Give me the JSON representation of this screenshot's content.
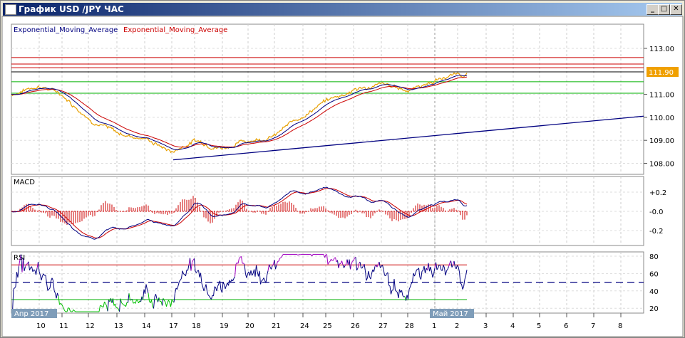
{
  "window": {
    "title": "График USD /JPY  ЧАС",
    "minimize": "_",
    "maximize": "□",
    "close": "✕"
  },
  "legend": {
    "ema_fast": "Exponential_Moving_Average",
    "ema_slow": "Exponential_Moving_Average"
  },
  "colors": {
    "price": "#e8a000",
    "ema_fast": "#000080",
    "ema_slow": "#cc0000",
    "level_red": "#cc0000",
    "level_green": "#00b000",
    "trend": "#000080",
    "current": "#f0a000"
  },
  "chart_data": [
    {
      "type": "line",
      "title": "USD/JPY H1",
      "ylabel": "",
      "ylim": [
        107.8,
        113.9
      ],
      "y_ticks": [
        "113.00",
        "111.00",
        "110.00",
        "109.00",
        "108.00"
      ],
      "current_price_label": "111.90",
      "x_ticks": [
        "10",
        "11",
        "12",
        "13",
        "14",
        "17",
        "18",
        "19",
        "20",
        "21",
        "24",
        "25",
        "26",
        "27",
        "28",
        "1",
        "2",
        "3",
        "4",
        "5",
        "6",
        "7",
        "8"
      ],
      "month_labels": [
        "Апр 2017",
        "Май 2017"
      ],
      "price_anchors": [
        111.0,
        111.4,
        111.0,
        110.0,
        109.3,
        109.1,
        108.5,
        109.0,
        108.7,
        109.0,
        109.2,
        110.1,
        110.7,
        111.2,
        111.4,
        111.2,
        111.6,
        111.9
      ],
      "levels_red": [
        112.6,
        112.32,
        112.16
      ],
      "level_black": 111.98,
      "levels_green": [
        111.55,
        111.05
      ],
      "trendline": {
        "from": 108.15,
        "to": 110.05
      }
    },
    {
      "type": "line",
      "title": "MACD",
      "y_ticks": [
        "+0.2",
        "-0.0",
        "-0.2"
      ],
      "ylim": [
        -0.32,
        0.32
      ]
    },
    {
      "type": "line",
      "title": "RSI",
      "y_ticks": [
        "80",
        "60",
        "40",
        "20"
      ],
      "ylim": [
        15,
        85
      ],
      "levels": [
        70,
        50,
        30
      ]
    }
  ]
}
